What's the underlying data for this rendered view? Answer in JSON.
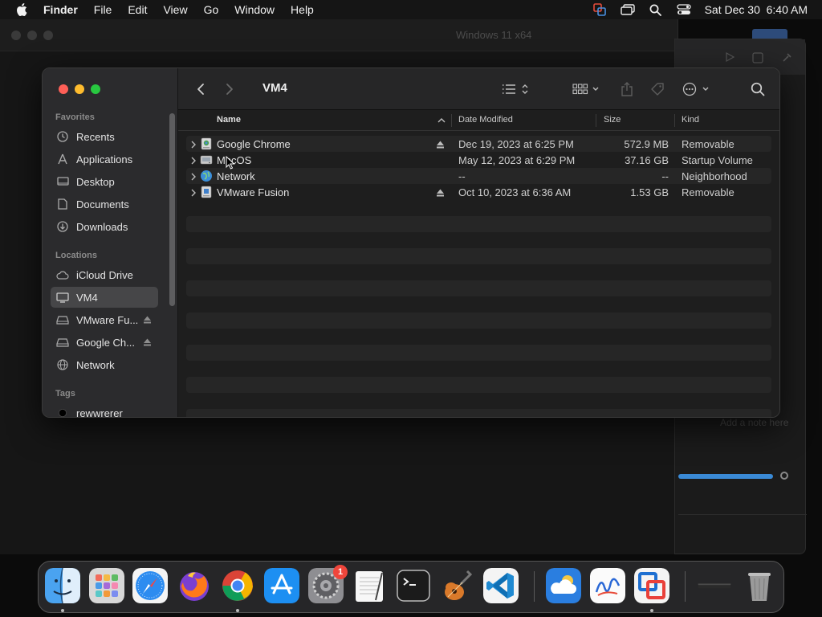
{
  "menubar": {
    "app_name": "Finder",
    "items": [
      "File",
      "Edit",
      "View",
      "Go",
      "Window",
      "Help"
    ],
    "datetime": "Sat Dec 30  6:40 AM",
    "status_icons": [
      "parallels-icon",
      "screen-mirror-icon",
      "spotlight-icon",
      "control-center-icon"
    ]
  },
  "background_window": {
    "title": "Windows 11 x64",
    "note_placeholder": "Add a note here"
  },
  "finder": {
    "title": "VM4",
    "sidebar": {
      "favorites_title": "Favorites",
      "favorites": [
        {
          "label": "Recents",
          "icon": "clock-icon"
        },
        {
          "label": "Applications",
          "icon": "applications-icon"
        },
        {
          "label": "Desktop",
          "icon": "desktop-icon"
        },
        {
          "label": "Documents",
          "icon": "document-icon"
        },
        {
          "label": "Downloads",
          "icon": "download-icon"
        }
      ],
      "locations_title": "Locations",
      "locations": [
        {
          "label": "iCloud Drive",
          "icon": "cloud-icon",
          "eject": false,
          "selected": false
        },
        {
          "label": "VM4",
          "icon": "computer-icon",
          "eject": false,
          "selected": true
        },
        {
          "label": "VMware Fu...",
          "icon": "drive-icon",
          "eject": true,
          "selected": false
        },
        {
          "label": "Google Ch...",
          "icon": "drive-icon",
          "eject": true,
          "selected": false
        },
        {
          "label": "Network",
          "icon": "globe-icon",
          "eject": false,
          "selected": false
        }
      ],
      "tags_title": "Tags",
      "tags": [
        {
          "label": "rewwrerer",
          "color": "#000000"
        }
      ]
    },
    "columns": {
      "name": "Name",
      "date": "Date Modified",
      "size": "Size",
      "kind": "Kind"
    },
    "rows": [
      {
        "name": "Google Chrome",
        "icon": "disk-image-icon",
        "eject": true,
        "date": "Dec 19, 2023 at 6:25 PM",
        "size": "572.9 MB",
        "kind": "Removable"
      },
      {
        "name": "MacOS",
        "icon": "hard-drive-icon",
        "eject": false,
        "date": "May 12, 2023 at 6:29 PM",
        "size": "37.16 GB",
        "kind": "Startup Volume"
      },
      {
        "name": "Network",
        "icon": "network-globe-icon",
        "eject": false,
        "date": "--",
        "size": "--",
        "kind": "Neighborhood"
      },
      {
        "name": "VMware Fusion",
        "icon": "disk-image-icon",
        "eject": true,
        "date": "Oct 10, 2023 at 6:36 AM",
        "size": "1.53 GB",
        "kind": "Removable"
      }
    ]
  },
  "dock": {
    "apps": [
      {
        "name": "Finder",
        "running": true
      },
      {
        "name": "Launchpad",
        "running": false
      },
      {
        "name": "Safari",
        "running": false
      },
      {
        "name": "Firefox",
        "running": false
      },
      {
        "name": "Google Chrome",
        "running": true
      },
      {
        "name": "App Store",
        "running": false
      },
      {
        "name": "System Settings",
        "running": false,
        "badge": "1"
      },
      {
        "name": "TextEdit",
        "running": false
      },
      {
        "name": "Terminal",
        "running": false
      },
      {
        "name": "GarageBand",
        "running": false
      },
      {
        "name": "Visual Studio Code",
        "running": false
      },
      {
        "name": "Weather",
        "running": false
      },
      {
        "name": "Freeform",
        "running": false
      },
      {
        "name": "VMware Fusion",
        "running": true
      },
      {
        "name": "Disk",
        "running": false
      },
      {
        "name": "Trash",
        "running": false
      }
    ]
  }
}
